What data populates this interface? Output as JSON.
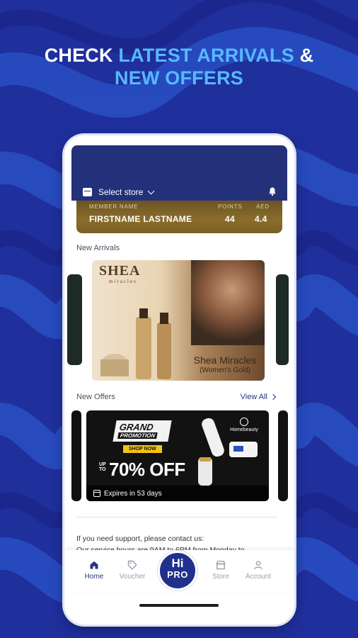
{
  "promo": {
    "headline_part1": "CHECK ",
    "headline_accent1": "LATEST ARRIVALS",
    "headline_part2": " &",
    "headline_accent2": "NEW OFFERS",
    "colors": {
      "background": "#1f2f9c",
      "accent": "#57b8ff",
      "header": "#23307a"
    }
  },
  "header": {
    "store_selector_label": "Select store",
    "store_icon": "store-icon",
    "notification_icon": "bell-icon"
  },
  "member_card": {
    "name_label": "MEMBER NAME",
    "name_value": "FIRSTNAME  LASTNAME",
    "points_label": "POINTS",
    "points_value": "44",
    "aed_label": "AED",
    "aed_value": "4.4"
  },
  "new_arrivals": {
    "title": "New Arrivals",
    "banner": {
      "brand": "SHEA",
      "brand_sub": "miracles",
      "caption_title": "Shea Miracles",
      "caption_sub": "(Women's Gold)"
    }
  },
  "new_offers": {
    "title": "New Offers",
    "view_all": "View All",
    "banner": {
      "headline": "GRAND",
      "sub": "PROMOTION",
      "cta": "SHOP NOW",
      "upto": "UP TO",
      "discount": "70% OFF",
      "partner": "Homebeauty",
      "expires": "Expires in 53 days"
    }
  },
  "support": {
    "line1": "If you need support, please contact us:",
    "line2": "Our service hours are 9AM to 6PM from Monday to"
  },
  "bottom_nav": {
    "items": [
      {
        "label": "Home",
        "icon": "home-icon",
        "active": true
      },
      {
        "label": "Voucher",
        "icon": "tag-icon",
        "active": false
      },
      {
        "label": "Store",
        "icon": "store-icon",
        "active": false
      },
      {
        "label": "Account",
        "icon": "person-icon",
        "active": false
      }
    ],
    "center_logo_line1": "Hi",
    "center_logo_line2": "PRO"
  }
}
